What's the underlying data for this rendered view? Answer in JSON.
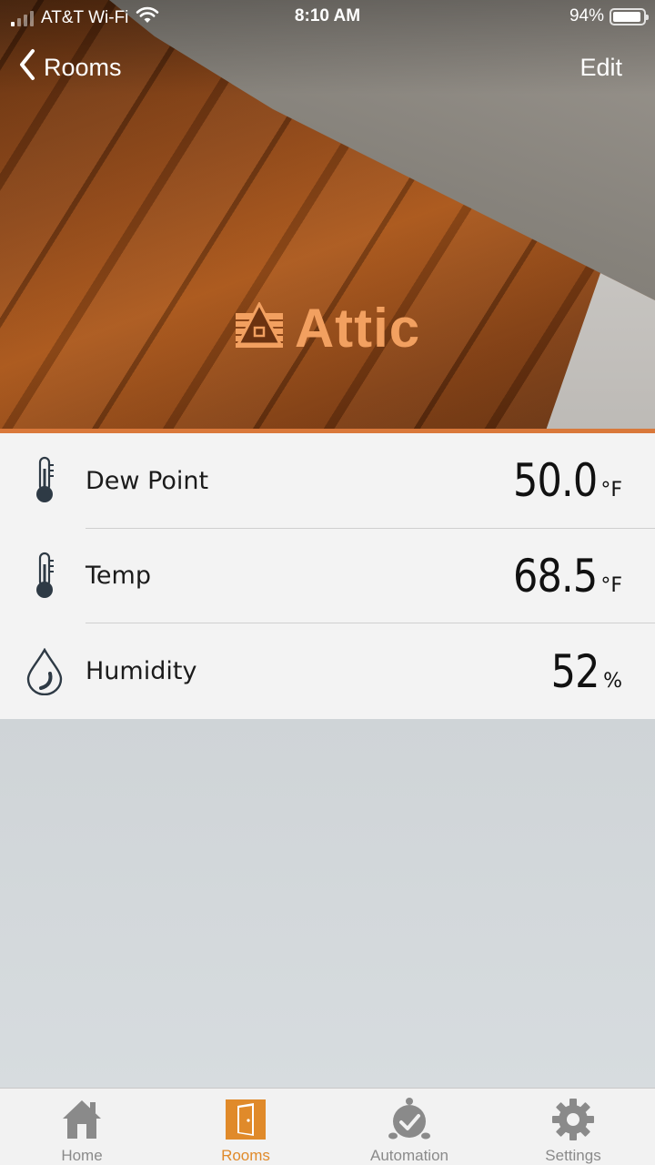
{
  "status_bar": {
    "carrier": "AT&T Wi-Fi",
    "time": "8:10 AM",
    "battery": "94%"
  },
  "nav": {
    "back_label": "Rooms",
    "edit_label": "Edit"
  },
  "room": {
    "name": "Attic",
    "icon": "attic-icon"
  },
  "sensors": [
    {
      "icon": "thermometer-icon",
      "label": "Dew Point",
      "value": "50.0",
      "unit": "°F"
    },
    {
      "icon": "thermometer-icon",
      "label": "Temp",
      "value": "68.5",
      "unit": "°F"
    },
    {
      "icon": "water-drop-icon",
      "label": "Humidity",
      "value": "52",
      "unit": "%"
    }
  ],
  "tabs": [
    {
      "icon": "home-icon",
      "label": "Home",
      "active": false
    },
    {
      "icon": "door-icon",
      "label": "Rooms",
      "active": true
    },
    {
      "icon": "automation-icon",
      "label": "Automation",
      "active": false
    },
    {
      "icon": "gear-icon",
      "label": "Settings",
      "active": false
    }
  ],
  "colors": {
    "accent": "#e08a2a",
    "room_title": "#f2a060",
    "inactive_tab": "#8a8a8a"
  }
}
